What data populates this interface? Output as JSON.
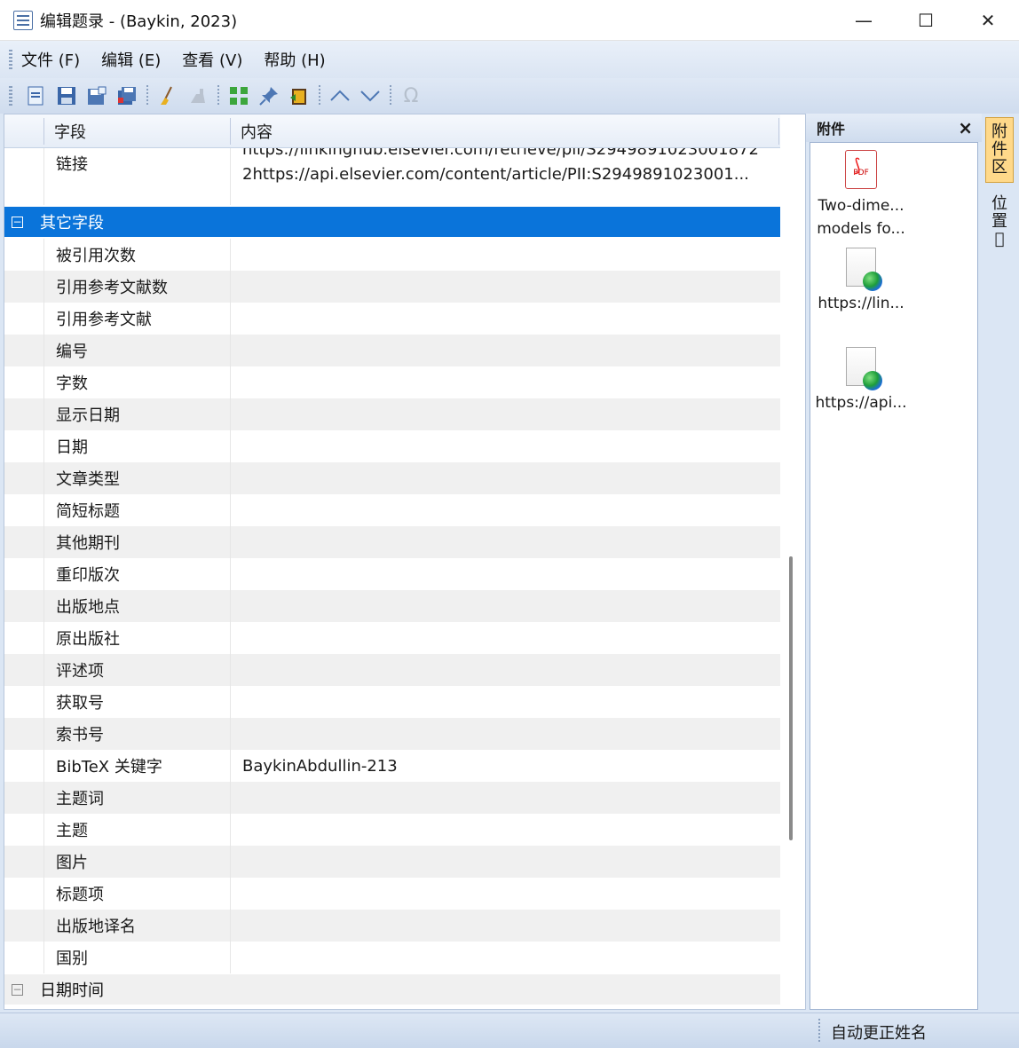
{
  "window": {
    "title": "编辑题录 - (Baykin, 2023)",
    "minimize": "—",
    "maximize": "☐",
    "close": "✕"
  },
  "menu": [
    "文件 (F)",
    "编辑 (E)",
    "查看 (V)",
    "帮助 (H)"
  ],
  "toolbar": {
    "icons": [
      "new-record-icon",
      "save-icon",
      "save-as-icon",
      "save-all-icon",
      "sep",
      "clean-icon",
      "clean-disabled-icon",
      "sep",
      "grid-icon",
      "pin-icon",
      "book-icon",
      "sep",
      "up-icon",
      "down-icon",
      "sep",
      "omega-icon"
    ]
  },
  "grid": {
    "headers": {
      "field": "字段",
      "content": "内容"
    },
    "link_row": {
      "field": "链接",
      "line1": "https://linkinghub.elsevier.com/retrieve/pii/S2949891023001872",
      "line2": "2https://api.elsevier.com/content/article/PII:S2949891023001..."
    },
    "group_other": {
      "toggle": "−",
      "label": "其它字段"
    },
    "rows": [
      {
        "field": "被引用次数",
        "content": ""
      },
      {
        "field": "引用参考文献数",
        "content": ""
      },
      {
        "field": "引用参考文献",
        "content": ""
      },
      {
        "field": "编号",
        "content": ""
      },
      {
        "field": "字数",
        "content": ""
      },
      {
        "field": "显示日期",
        "content": ""
      },
      {
        "field": "日期",
        "content": ""
      },
      {
        "field": "文章类型",
        "content": ""
      },
      {
        "field": "简短标题",
        "content": ""
      },
      {
        "field": "其他期刊",
        "content": ""
      },
      {
        "field": "重印版次",
        "content": ""
      },
      {
        "field": "出版地点",
        "content": ""
      },
      {
        "field": "原出版社",
        "content": ""
      },
      {
        "field": "评述项",
        "content": ""
      },
      {
        "field": "获取号",
        "content": ""
      },
      {
        "field": "索书号",
        "content": ""
      },
      {
        "field": "BibTeX 关键字",
        "content": "BaykinAbdullin-213"
      },
      {
        "field": "主题词",
        "content": ""
      },
      {
        "field": "主题",
        "content": ""
      },
      {
        "field": "图片",
        "content": ""
      },
      {
        "field": "标题项",
        "content": ""
      },
      {
        "field": "出版地译名",
        "content": ""
      },
      {
        "field": "国别",
        "content": ""
      }
    ],
    "group_datetime": {
      "toggle": "−",
      "label": "日期时间"
    }
  },
  "attachments": {
    "title": "附件",
    "close": "×",
    "items": [
      {
        "type": "pdf",
        "icon_text": "PDF",
        "line1": "Two-dime...",
        "line2": "models fo..."
      },
      {
        "type": "web",
        "line1": "https://lin..."
      },
      {
        "type": "web",
        "line1": "https://api..."
      }
    ]
  },
  "side_tabs": [
    {
      "chars": [
        "附",
        "件",
        "区"
      ],
      "active": true
    },
    {
      "chars": [
        "位",
        "置",
        "𢀳"
      ],
      "active": false
    }
  ],
  "status": {
    "text": "自动更正姓名"
  }
}
